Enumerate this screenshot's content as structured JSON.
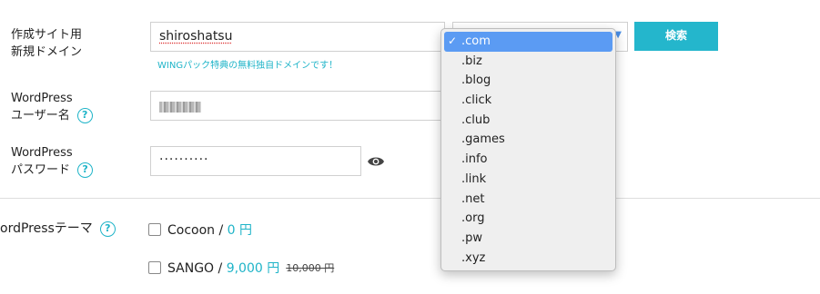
{
  "domain_row": {
    "label_line1": "作成サイト用",
    "label_line2": "新規ドメイン",
    "input_value": "shiroshatsu",
    "note": "WINGパック特典の無料独自ドメインです！",
    "search_button": "検索"
  },
  "dropdown": {
    "selected_index": 0,
    "options": [
      ".com",
      ".biz",
      ".blog",
      ".click",
      ".club",
      ".games",
      ".info",
      ".link",
      ".net",
      ".org",
      ".pw",
      ".xyz"
    ],
    "check_mark": "✓",
    "selected_bg": "#5b9bf3"
  },
  "username_row": {
    "label_line1": "WordPress",
    "label_line2": "ユーザー名",
    "help_icon": "?"
  },
  "password_row": {
    "label_line1": "WordPress",
    "label_line2": "パスワード",
    "help_icon": "?",
    "masked_value": "··········",
    "eye_icon": "eye-icon"
  },
  "theme_row": {
    "label": "ordPressテーマ",
    "help_icon": "?",
    "options": [
      {
        "name": "Cocoon / ",
        "price": "0 円",
        "old_price": ""
      },
      {
        "name": "SANGO / ",
        "price": "9,000 円",
        "old_price": "10,000 円"
      }
    ]
  },
  "colors": {
    "accent": "#1fb4c8",
    "button": "#24b6cc"
  }
}
